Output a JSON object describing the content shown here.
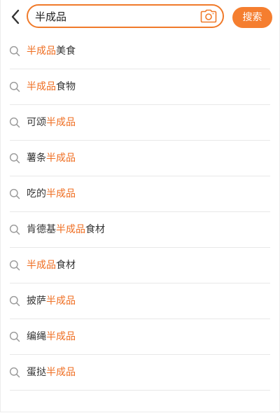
{
  "search": {
    "query": "半成品",
    "button_label": "搜索"
  },
  "colors": {
    "accent": "#f57e2f",
    "highlight": "#ef6d20"
  },
  "icons": {
    "back": "back-arrow-icon",
    "camera": "camera-icon",
    "search": "search-icon"
  },
  "suggestions": [
    {
      "prefix": "",
      "highlight": "半成品",
      "suffix": "美食"
    },
    {
      "prefix": "",
      "highlight": "半成品",
      "suffix": "食物"
    },
    {
      "prefix": "可颂",
      "highlight": "半成品",
      "suffix": ""
    },
    {
      "prefix": "薯条",
      "highlight": "半成品",
      "suffix": ""
    },
    {
      "prefix": "吃的",
      "highlight": "半成品",
      "suffix": ""
    },
    {
      "prefix": "肯德基",
      "highlight": "半成品",
      "suffix": "食材"
    },
    {
      "prefix": "",
      "highlight": "半成品",
      "suffix": "食材"
    },
    {
      "prefix": "披萨",
      "highlight": "半成品",
      "suffix": ""
    },
    {
      "prefix": "编绳",
      "highlight": "半成品",
      "suffix": ""
    },
    {
      "prefix": "蛋挞",
      "highlight": "半成品",
      "suffix": ""
    }
  ]
}
